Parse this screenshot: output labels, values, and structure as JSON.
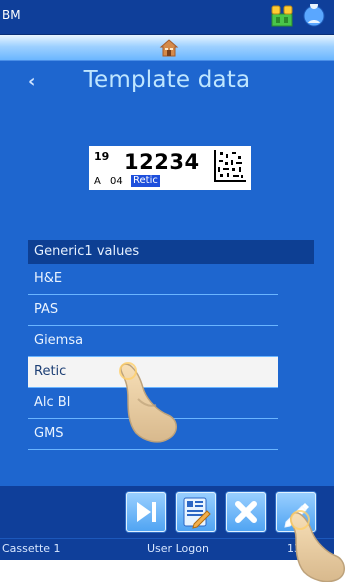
{
  "topbar": {
    "title": "BM"
  },
  "page": {
    "title": "Template data",
    "back_chevron": "‹"
  },
  "label_preview": {
    "superscript": "19",
    "number": "12234",
    "a": "A",
    "code": "04",
    "highlight": "Retic"
  },
  "list": {
    "header": "Generic1 values",
    "items": [
      {
        "label": "H&E"
      },
      {
        "label": "PAS"
      },
      {
        "label": "Giemsa"
      },
      {
        "label": "Retic",
        "selected": true
      },
      {
        "label": "Alc Bl"
      },
      {
        "label": "GMS"
      }
    ]
  },
  "toolbar": {
    "buttons": [
      {
        "icon": "skip-forward-icon"
      },
      {
        "icon": "edit-template-icon"
      },
      {
        "icon": "close-icon"
      },
      {
        "icon": "pencil-icon"
      }
    ]
  },
  "status": {
    "left": "Cassette 1",
    "center": "User Logon",
    "time": "13:49"
  },
  "colors": {
    "screen_bg": "#1e66cf",
    "bar_bg": "#0f3f9a",
    "title_text": "#bfe6ff",
    "selected_row": "#f4f4f4",
    "accent_label": "#1e4fdc"
  }
}
